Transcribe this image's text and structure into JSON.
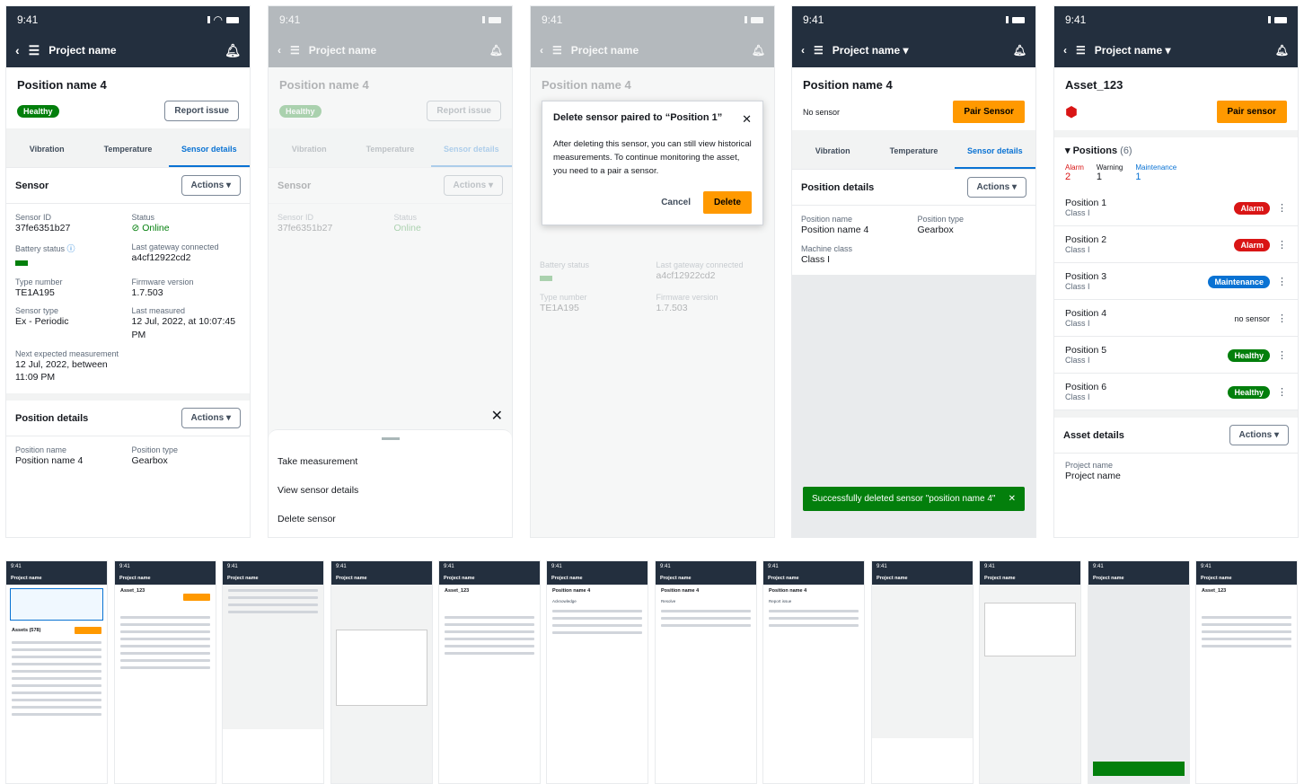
{
  "status_time": "9:41",
  "nav": {
    "project": "Project name"
  },
  "screen1": {
    "title": "Position name 4",
    "health": "Healthy",
    "report": "Report issue",
    "tabs": [
      "Vibration",
      "Temperature",
      "Sensor details"
    ],
    "sensor_header": "Sensor",
    "actions": "Actions",
    "fields": {
      "sensor_id_label": "Sensor ID",
      "sensor_id": "37fe6351b27",
      "status_label": "Status",
      "status": "Online",
      "battery_label": "Battery status",
      "gateway_label": "Last gateway connected",
      "gateway": "a4cf12922cd2",
      "type_label": "Type number",
      "type": "TE1A195",
      "firmware_label": "Firmware version",
      "firmware": "1.7.503",
      "sensor_type_label": "Sensor type",
      "sensor_type": "Ex - Periodic",
      "last_label": "Last measured",
      "last": "12 Jul, 2022, at 10:07:45 PM",
      "next_label": "Next expected measurement",
      "next": "12 Jul, 2022, between 11:09 PM"
    },
    "position_details": "Position details",
    "pos_name_label": "Position name",
    "pos_name": "Position name 4",
    "pos_type_label": "Position type",
    "pos_type": "Gearbox"
  },
  "screen2": {
    "sheet_items": [
      "Take measurement",
      "View sensor details",
      "Delete sensor"
    ]
  },
  "screen3": {
    "modal_title": "Delete sensor paired to “Position 1”",
    "modal_body": "After deleting this sensor, you can still view historical measurements. To continue monitoring the asset, you need to a pair a sensor.",
    "cancel": "Cancel",
    "delete": "Delete"
  },
  "screen4": {
    "no_sensor": "No sensor",
    "pair": "Pair Sensor",
    "position_details": "Position details",
    "machine_label": "Machine class",
    "machine": "Class I",
    "toast": "Successfully deleted sensor \"position name 4\""
  },
  "screen5": {
    "title": "Asset_123",
    "pair": "Pair sensor",
    "positions_label": "Positions",
    "positions_count": "(6)",
    "alarm_label": "Alarm",
    "alarm_count": "2",
    "warning_label": "Warning",
    "warning_count": "1",
    "maint_label": "Maintenance",
    "maint_count": "1",
    "positions": [
      {
        "name": "Position 1",
        "class": "Class I",
        "badge": "Alarm",
        "kind": "alarm"
      },
      {
        "name": "Position 2",
        "class": "Class I",
        "badge": "Alarm",
        "kind": "alarm"
      },
      {
        "name": "Position 3",
        "class": "Class I",
        "badge": "Maintenance",
        "kind": "maint"
      },
      {
        "name": "Position 4",
        "class": "Class I",
        "badge": "no sensor",
        "kind": "none"
      },
      {
        "name": "Position 5",
        "class": "Class I",
        "badge": "Healthy",
        "kind": "healthy"
      },
      {
        "name": "Position 6",
        "class": "Class I",
        "badge": "Healthy",
        "kind": "healthy"
      }
    ],
    "asset_details": "Asset details",
    "actions": "Actions",
    "project_label": "Project name",
    "project": "Project name"
  },
  "thumbs": {
    "t1_title": "Assets (578)",
    "t1_btn": "Add asset",
    "t5_title": "Position name 4",
    "t5_btn": "Acknowledge",
    "t6_btn": "Resolve",
    "t7_btn": "Report issue"
  }
}
